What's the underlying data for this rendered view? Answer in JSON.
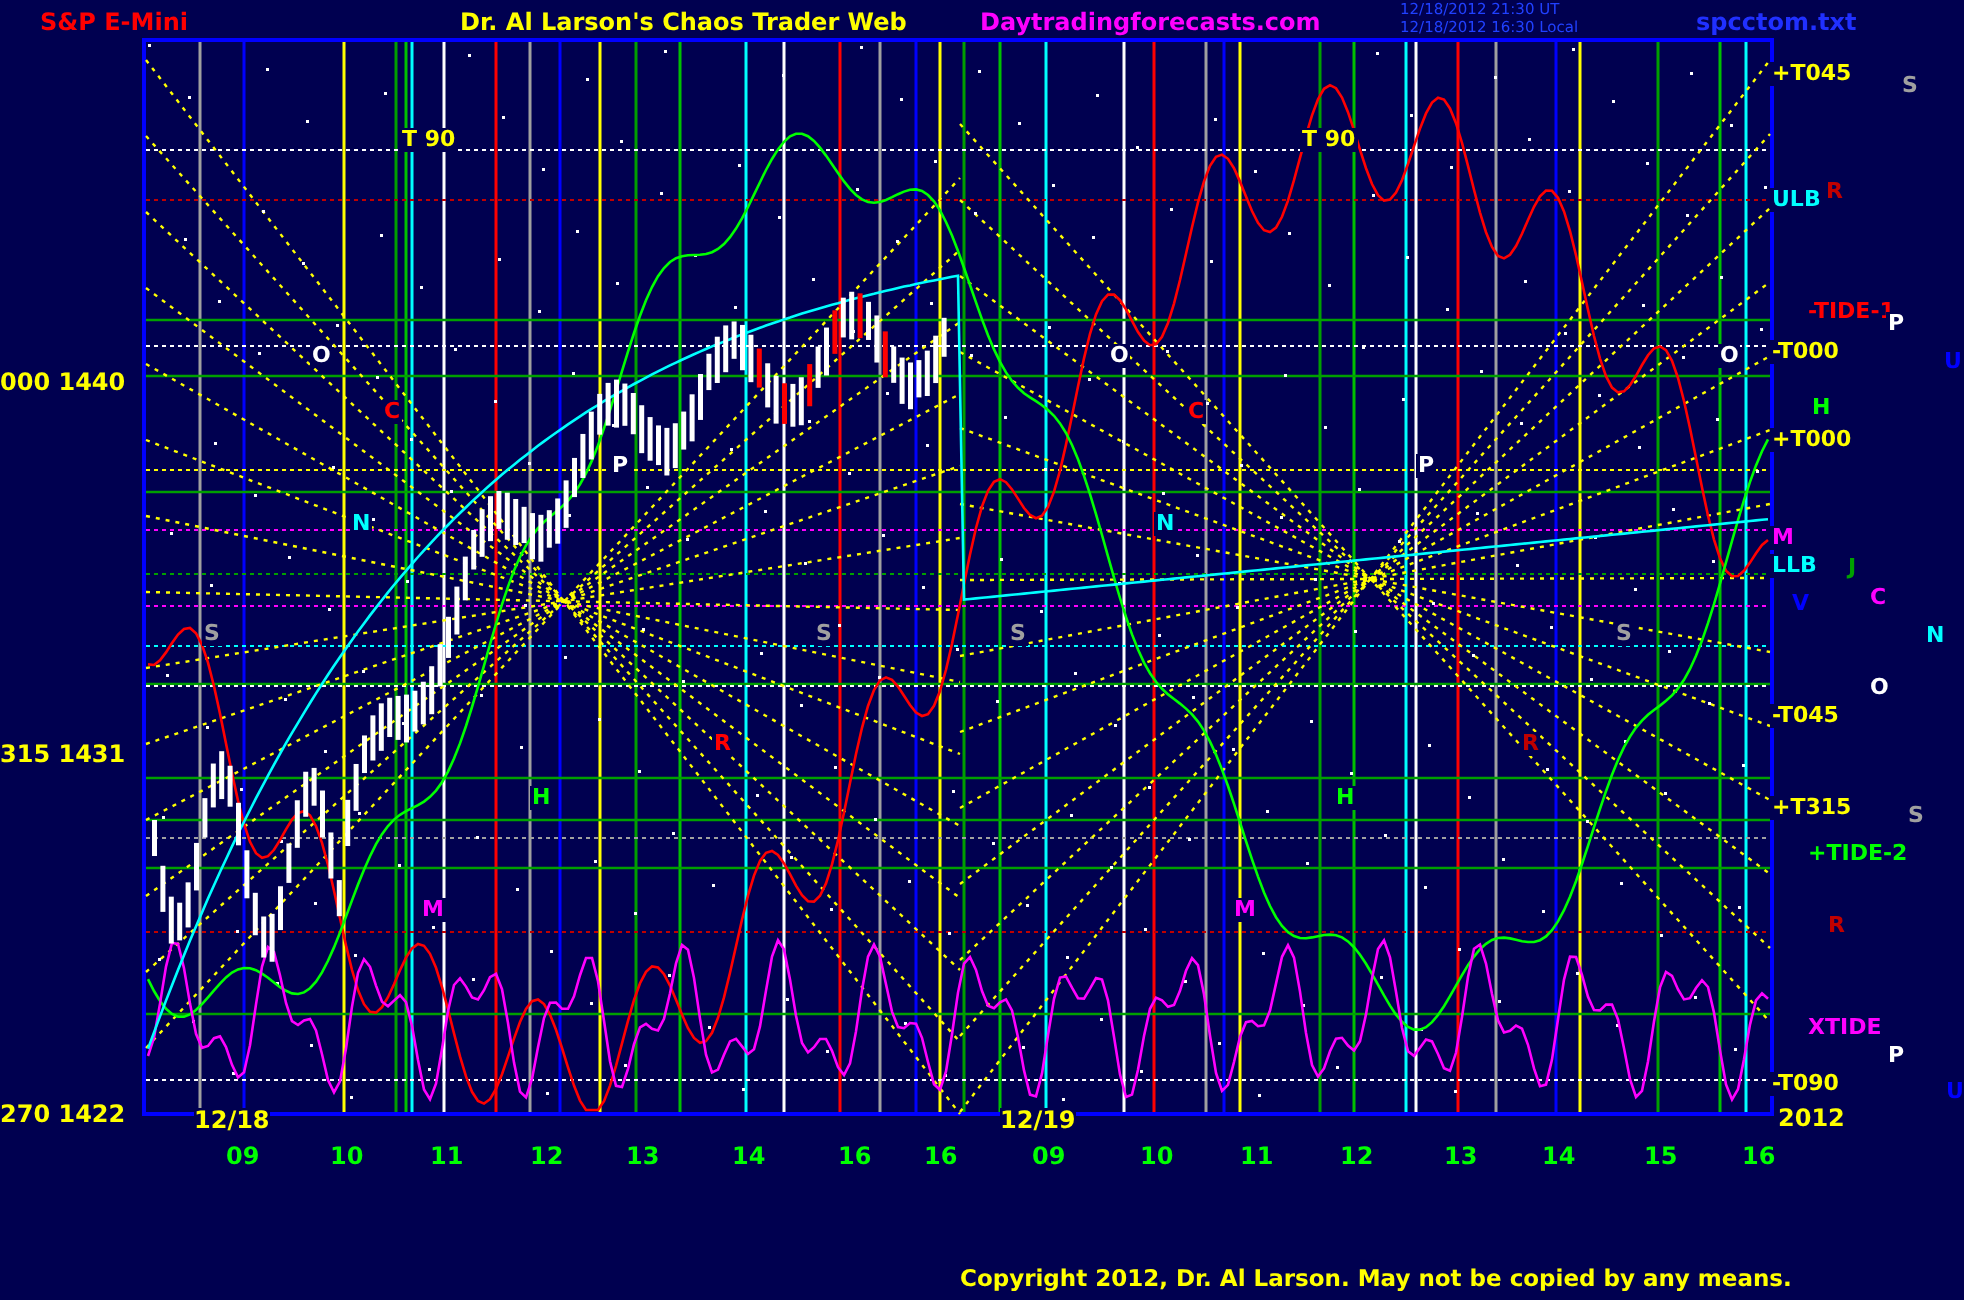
{
  "header": {
    "symbol": "S&P E-Mini",
    "title": "Dr. Al Larson's Chaos Trader Web",
    "site": "Daytradingforecasts.com",
    "timestamps": [
      "12/18/2012 21:30 UT",
      "12/18/2012 16:30 Local"
    ],
    "file": "spcctom.txt"
  },
  "chart": {
    "y_labels": [
      "000 1440",
      "315 1431",
      "270 1422"
    ],
    "x_labels": [
      "09",
      "10",
      "11",
      "12",
      "13",
      "14",
      "16",
      "16",
      "09",
      "10",
      "11",
      "12",
      "13",
      "14",
      "15",
      "16"
    ],
    "date_labels": [
      "12/18",
      "12/19"
    ],
    "year": "2012",
    "plot_labels": [
      {
        "text": "T 90",
        "color": "#ffff00"
      },
      {
        "text": "T 90",
        "color": "#ffff00"
      },
      {
        "text": "O",
        "color": "#ffffff"
      },
      {
        "text": "C",
        "color": "#ff0000"
      },
      {
        "text": "N",
        "color": "#00ffff"
      },
      {
        "text": "S",
        "color": "#a0a0a0"
      },
      {
        "text": "P",
        "color": "#ffffff"
      },
      {
        "text": "S",
        "color": "#a0a0a0"
      },
      {
        "text": "H",
        "color": "#00ff00"
      },
      {
        "text": "M",
        "color": "#ff00ff"
      },
      {
        "text": "R",
        "color": "#ff0000"
      },
      {
        "text": "O",
        "color": "#ffffff"
      },
      {
        "text": "C",
        "color": "#ff0000"
      },
      {
        "text": "N",
        "color": "#00ffff"
      },
      {
        "text": "S",
        "color": "#a0a0a0"
      },
      {
        "text": "P",
        "color": "#ffffff"
      },
      {
        "text": "S",
        "color": "#a0a0a0"
      },
      {
        "text": "H",
        "color": "#00ff00"
      },
      {
        "text": "M",
        "color": "#ff00ff"
      },
      {
        "text": "R",
        "color": "#c00000"
      },
      {
        "text": "O",
        "color": "#ffffff"
      }
    ],
    "right_labels": [
      {
        "text": "+T045",
        "color": "#ffff00"
      },
      {
        "text": "S",
        "color": "#a0a0a0"
      },
      {
        "text": "ULB",
        "color": "#00ffff"
      },
      {
        "text": "R",
        "color": "#c00000"
      },
      {
        "text": "-TIDE-1",
        "color": "#ff0000"
      },
      {
        "text": "P",
        "color": "#ffffff"
      },
      {
        "text": "-T000",
        "color": "#ffff00"
      },
      {
        "text": "U",
        "color": "#0000ff"
      },
      {
        "text": "H",
        "color": "#00ff00"
      },
      {
        "text": "+T000",
        "color": "#ffff00"
      },
      {
        "text": "M",
        "color": "#ff00ff"
      },
      {
        "text": "LLB",
        "color": "#00ffff"
      },
      {
        "text": "J",
        "color": "#00a000"
      },
      {
        "text": "V",
        "color": "#0000ff"
      },
      {
        "text": "C",
        "color": "#ff00ff"
      },
      {
        "text": "N",
        "color": "#00ffff"
      },
      {
        "text": "O",
        "color": "#ffffff"
      },
      {
        "text": "-T045",
        "color": "#ffff00"
      },
      {
        "text": "+T315",
        "color": "#ffff00"
      },
      {
        "text": "S",
        "color": "#a0a0a0"
      },
      {
        "text": "+TIDE-2",
        "color": "#00ff00"
      },
      {
        "text": "R",
        "color": "#c00000"
      },
      {
        "text": "XTIDE",
        "color": "#ff00ff"
      },
      {
        "text": "P",
        "color": "#ffffff"
      },
      {
        "text": "-T090",
        "color": "#ffff00"
      },
      {
        "text": "U",
        "color": "#0000ff"
      }
    ]
  },
  "footer": "Copyright 2012, Dr. Al Larson. May not be copied by any means."
}
